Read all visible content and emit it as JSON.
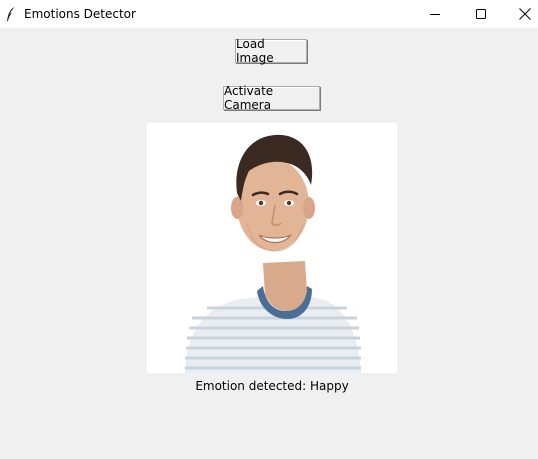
{
  "window": {
    "title": "Emotions Detector",
    "app_icon": "feather-icon",
    "controls": {
      "minimize_icon": "minimize-icon",
      "maximize_icon": "maximize-icon",
      "close_icon": "close-icon"
    }
  },
  "buttons": {
    "load_image": "Load Image",
    "activate_camera": "Activate Camera"
  },
  "image": {
    "subject": "smiling-man-photo"
  },
  "result": {
    "text": "Emotion detected: Happy"
  },
  "colors": {
    "window_bg": "#f0f0f0",
    "titlebar_bg": "#ffffff",
    "shirt_stripe": "#c9d3dc",
    "collar": "#4a6f96"
  }
}
